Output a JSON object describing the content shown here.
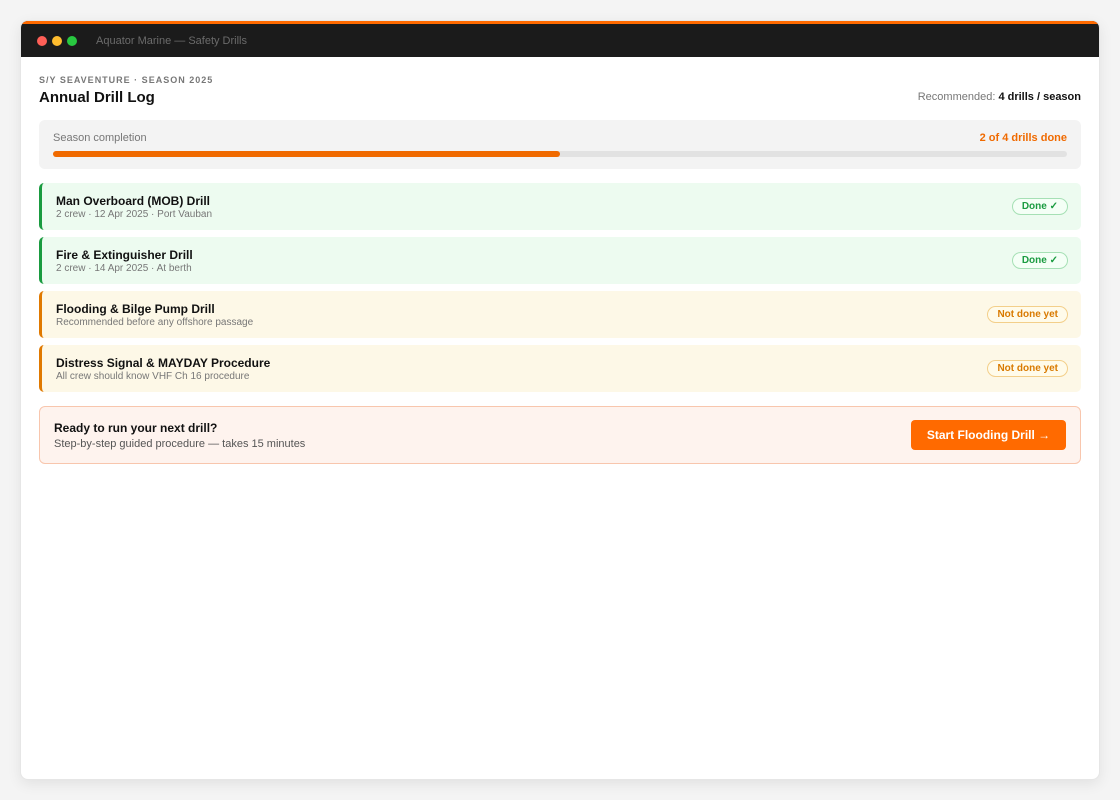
{
  "window": {
    "title": "Aquator Marine — Safety Drills"
  },
  "header": {
    "kicker": "S/Y SEAVENTURE · SEASON 2025",
    "title": "Annual Drill Log",
    "recommend_label": "Recommended:",
    "recommend_value": "4 drills / season"
  },
  "progress": {
    "label": "Season completion",
    "count_text": "2 of 4 drills done",
    "completed": 2,
    "total": 4
  },
  "drills": [
    {
      "name": "Man Overboard (MOB) Drill",
      "detail": "2 crew · 12 Apr 2025 · Port Vauban",
      "status": "Done ✓",
      "state": "done"
    },
    {
      "name": "Fire & Extinguisher Drill",
      "detail": "2 crew · 14 Apr 2025 · At berth",
      "status": "Done ✓",
      "state": "done"
    },
    {
      "name": "Flooding & Bilge Pump Drill",
      "detail": "Recommended before any offshore passage",
      "status": "Not done yet",
      "state": "pending"
    },
    {
      "name": "Distress Signal & MAYDAY Procedure",
      "detail": "All crew should know VHF Ch 16 procedure",
      "status": "Not done yet",
      "state": "pending"
    }
  ],
  "cta": {
    "title": "Ready to run your next drill?",
    "subtitle": "Step-by-step guided procedure — takes 15 minutes",
    "button_label": "Start Flooding Drill →"
  },
  "colors": {
    "accent": "#ff6a00",
    "done": "#1a9b40",
    "pending": "#e07900"
  }
}
